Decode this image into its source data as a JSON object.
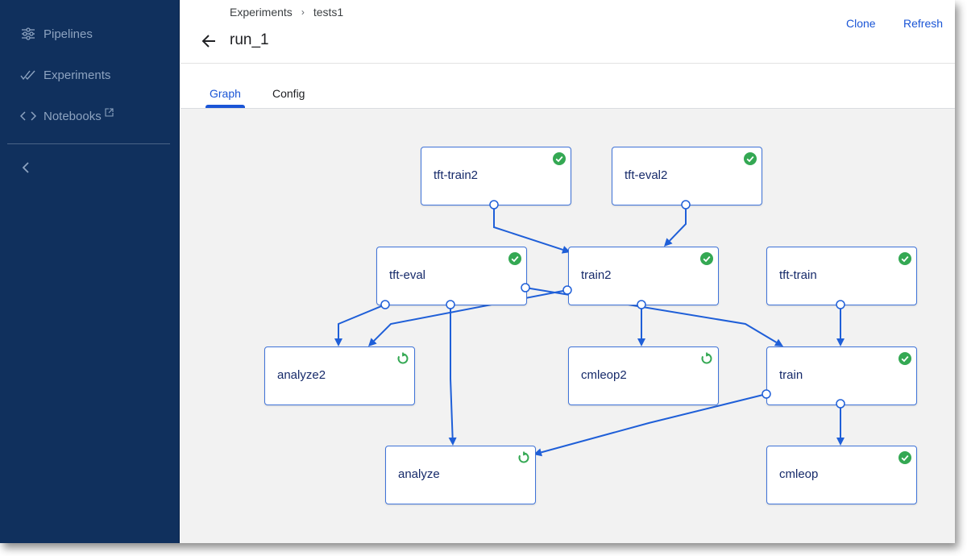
{
  "sidebar": {
    "items": [
      {
        "label": "Pipelines",
        "icon": "pipelines-icon"
      },
      {
        "label": "Experiments",
        "icon": "experiments-icon"
      },
      {
        "label": "Notebooks",
        "icon": "notebooks-icon",
        "external": true
      }
    ],
    "collapse_icon": "chevron-left-icon"
  },
  "header": {
    "breadcrumb": [
      "Experiments",
      "tests1"
    ],
    "breadcrumb_separator": "›",
    "title": "run_1",
    "back_icon": "arrow-back-icon",
    "actions": {
      "clone": "Clone",
      "refresh": "Refresh"
    }
  },
  "tabs": [
    {
      "label": "Graph",
      "active": true
    },
    {
      "label": "Config",
      "active": false
    }
  ],
  "colors": {
    "sidebar_bg": "#10305d",
    "accent": "#1a55d6",
    "edge": "#1f5fd8",
    "success": "#34a853",
    "running": "#34a853"
  },
  "graph": {
    "nodes": [
      {
        "id": "tft-train2",
        "label": "tft-train2",
        "status": "succeeded"
      },
      {
        "id": "tft-eval2",
        "label": "tft-eval2",
        "status": "succeeded"
      },
      {
        "id": "tft-eval",
        "label": "tft-eval",
        "status": "succeeded"
      },
      {
        "id": "train2",
        "label": "train2",
        "status": "succeeded"
      },
      {
        "id": "tft-train",
        "label": "tft-train",
        "status": "succeeded"
      },
      {
        "id": "analyze2",
        "label": "analyze2",
        "status": "running"
      },
      {
        "id": "cmleop2",
        "label": "cmleop2",
        "status": "running"
      },
      {
        "id": "train",
        "label": "train",
        "status": "succeeded"
      },
      {
        "id": "analyze",
        "label": "analyze",
        "status": "running"
      },
      {
        "id": "cmleop",
        "label": "cmleop",
        "status": "succeeded"
      }
    ],
    "edges": [
      {
        "from": "tft-train2",
        "to": "train2"
      },
      {
        "from": "tft-eval2",
        "to": "train2"
      },
      {
        "from": "tft-eval",
        "to": "analyze2"
      },
      {
        "from": "train2",
        "to": "analyze2"
      },
      {
        "from": "tft-eval",
        "to": "analyze"
      },
      {
        "from": "tft-eval",
        "to": "train"
      },
      {
        "from": "train2",
        "to": "cmleop2"
      },
      {
        "from": "tft-train",
        "to": "train"
      },
      {
        "from": "train",
        "to": "analyze"
      },
      {
        "from": "train",
        "to": "cmleop"
      }
    ]
  }
}
